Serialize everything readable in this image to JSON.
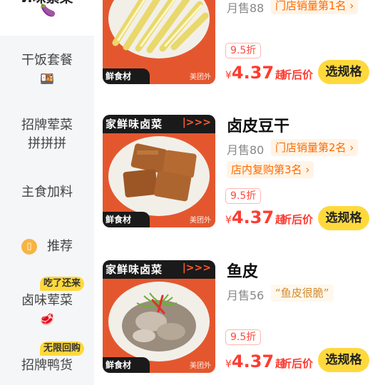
{
  "sidebar": {
    "top_item": {
      "label": "Ӣ味素菜",
      "emoji": "🍆"
    },
    "items": [
      {
        "label": "干饭套餐",
        "icon": "🍱"
      },
      {
        "label_line1": "招牌荤菜",
        "label_line2": "拼拼拼"
      },
      {
        "label": "主食加料"
      },
      {
        "label": "推荐",
        "icon_glyph": "▯"
      },
      {
        "label": "卤味荤菜",
        "badge": "吃了还来",
        "icon": "🥩"
      },
      {
        "label": "招牌鸭货",
        "badge": "无限回购"
      }
    ]
  },
  "products": [
    {
      "title": "",
      "sales": "月售88",
      "rank_tag": "门店销量第1名",
      "discount": "9.5折",
      "currency": "¥",
      "price": "4.37",
      "price_suffix": "起",
      "after_discount": "折后价",
      "button": "选规格"
    },
    {
      "title": "卤皮豆干",
      "sales": "月售80",
      "rank_tag": "门店销量第2名",
      "rank_tag2": "店内复购第3名",
      "discount": "9.5折",
      "currency": "¥",
      "price": "4.37",
      "price_suffix": "起",
      "after_discount": "折后价",
      "button": "选规格"
    },
    {
      "title": "鱼皮",
      "sales": "月售56",
      "quote": "“鱼皮很脆”",
      "discount": "9.5折",
      "currency": "¥",
      "price": "4.37",
      "price_suffix": "起",
      "after_discount": "折后价",
      "button": "选规格"
    }
  ],
  "thumb": {
    "banner": "家鲜味卤菜",
    "arrows": "|>>>",
    "foot": "鲜食材",
    "watermark": "美团外"
  },
  "colors": {
    "accent_yellow": "#ffd93c",
    "price_red": "#ff3b30",
    "rank_orange": "#ff6a00",
    "sidebar_bg": "#f5f6f8"
  }
}
